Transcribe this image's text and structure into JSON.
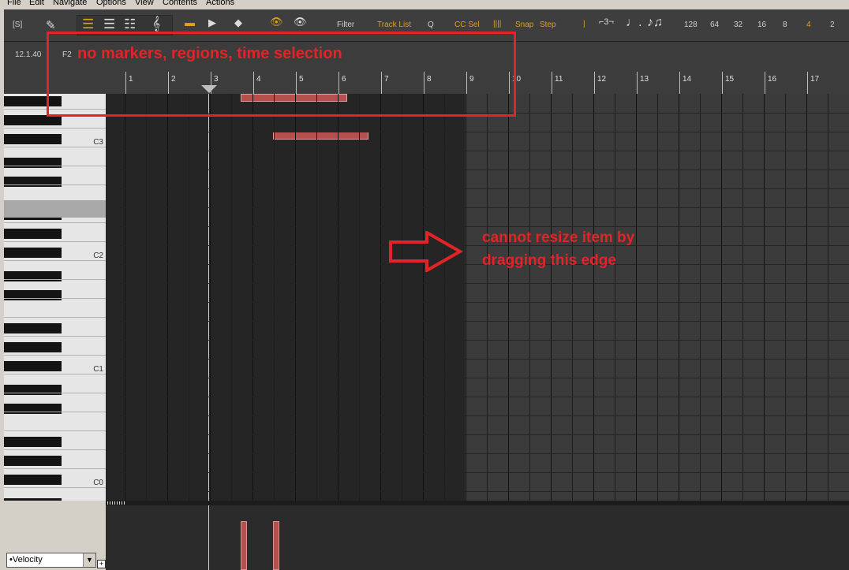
{
  "menu": [
    "File",
    "Edit",
    "Navigate",
    "Options",
    "View",
    "Contents",
    "Actions"
  ],
  "toolbar": {
    "s_label": "[S]",
    "filter": "Filter",
    "track_list": "Track List",
    "q": "Q",
    "cc_sel": "CC Sel",
    "snap": "Snap",
    "step": "Step",
    "grid_values": [
      "128",
      "64",
      "32",
      "16",
      "8",
      "4",
      "2"
    ]
  },
  "position": "12.1.40",
  "current_key": "F2",
  "ruler": [
    "1",
    "2",
    "3",
    "4",
    "5",
    "6",
    "7",
    "8",
    "9",
    "10",
    "11",
    "12",
    "13",
    "14",
    "15",
    "16",
    "17"
  ],
  "note_labels": [
    "C3",
    "C2",
    "C1",
    "C0"
  ],
  "cc_lane": {
    "selected": "•Velocity"
  },
  "annotations": {
    "box_text": "no markers, regions, time selection",
    "arrow_text_line1": "cannot resize item by",
    "arrow_text_line2": "dragging this edge"
  }
}
